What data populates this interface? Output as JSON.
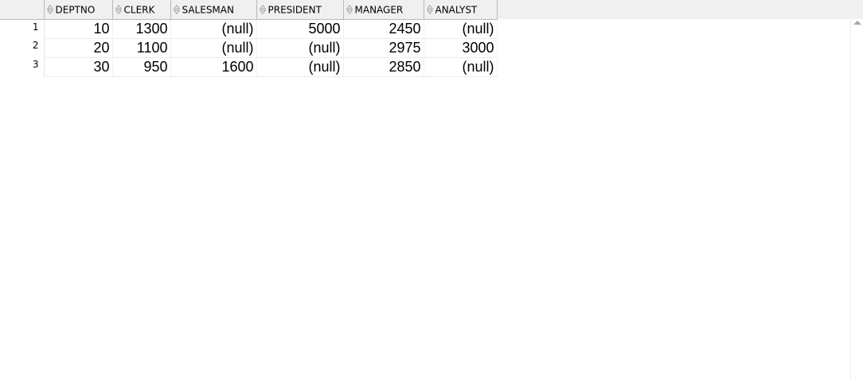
{
  "grid": {
    "columns": [
      {
        "label": "DEPTNO",
        "sort_icon": "sort-arrows-icon"
      },
      {
        "label": "CLERK",
        "sort_icon": "sort-arrows-icon"
      },
      {
        "label": "SALESMAN",
        "sort_icon": "sort-arrows-icon"
      },
      {
        "label": "PRESIDENT",
        "sort_icon": "sort-arrows-icon"
      },
      {
        "label": "MANAGER",
        "sort_icon": "sort-arrows-icon"
      },
      {
        "label": "ANALYST",
        "sort_icon": "sort-arrows-icon"
      }
    ],
    "rows": [
      {
        "num": "1",
        "cells": [
          "10",
          "1300",
          "(null)",
          "5000",
          "2450",
          "(null)"
        ]
      },
      {
        "num": "2",
        "cells": [
          "20",
          "1100",
          "(null)",
          "(null)",
          "2975",
          "3000"
        ]
      },
      {
        "num": "3",
        "cells": [
          "30",
          "950",
          "1600",
          "(null)",
          "2850",
          "(null)"
        ]
      }
    ]
  },
  "colors": {
    "header_bg": "#f0f0f0",
    "grid_line": "#b9b9b9"
  }
}
